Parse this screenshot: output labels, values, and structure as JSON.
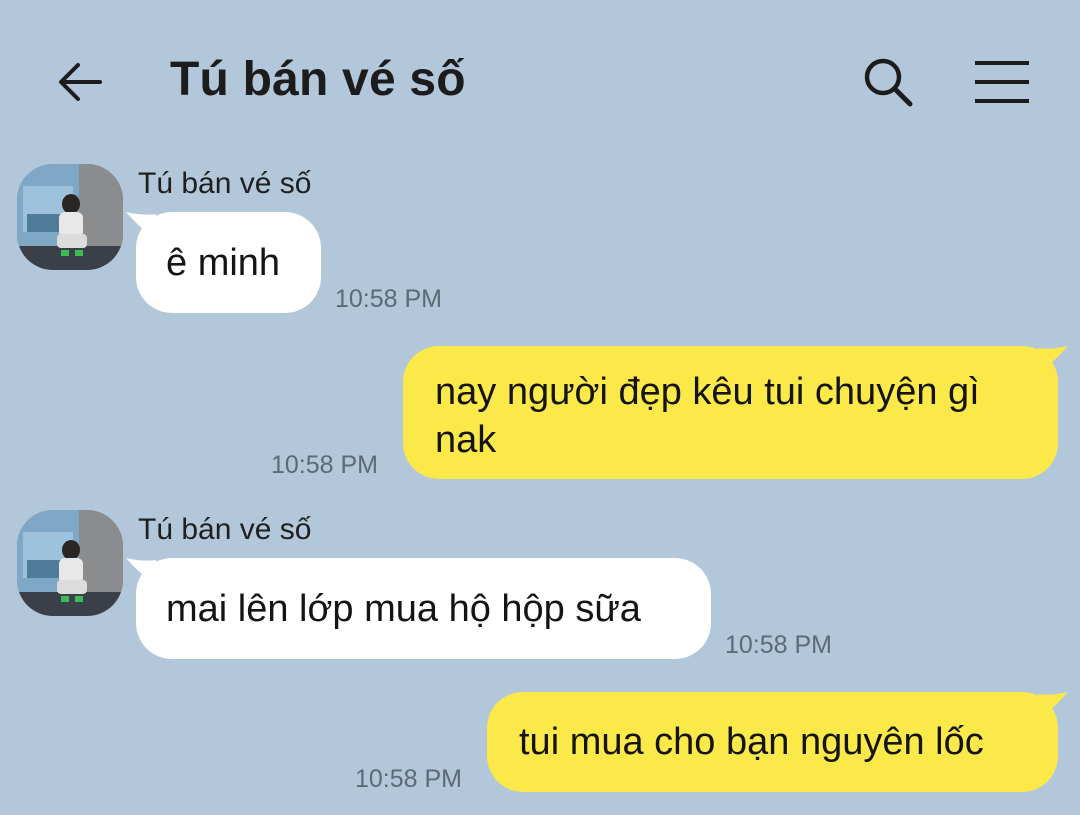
{
  "header": {
    "title": "Tú bán vé số",
    "back_icon": "arrow-left-icon",
    "search_icon": "search-icon",
    "menu_icon": "hamburger-menu-icon"
  },
  "colors": {
    "background": "#b2c7da",
    "incoming_bubble": "#ffffff",
    "outgoing_bubble": "#fbe94a"
  },
  "messages": [
    {
      "direction": "incoming",
      "sender": "Tú bán vé số",
      "text": "ê minh",
      "time": "10:58 PM"
    },
    {
      "direction": "outgoing",
      "text_line1": "nay người đẹp kêu tui chuyện gì",
      "text_line2": "nak",
      "time": "10:58 PM"
    },
    {
      "direction": "incoming",
      "sender": "Tú bán vé số",
      "text": "mai lên lớp mua hộ hộp sữa",
      "time": "10:58 PM"
    },
    {
      "direction": "outgoing",
      "text": "tui mua cho bạn nguyên lốc",
      "time": "10:58 PM"
    }
  ]
}
